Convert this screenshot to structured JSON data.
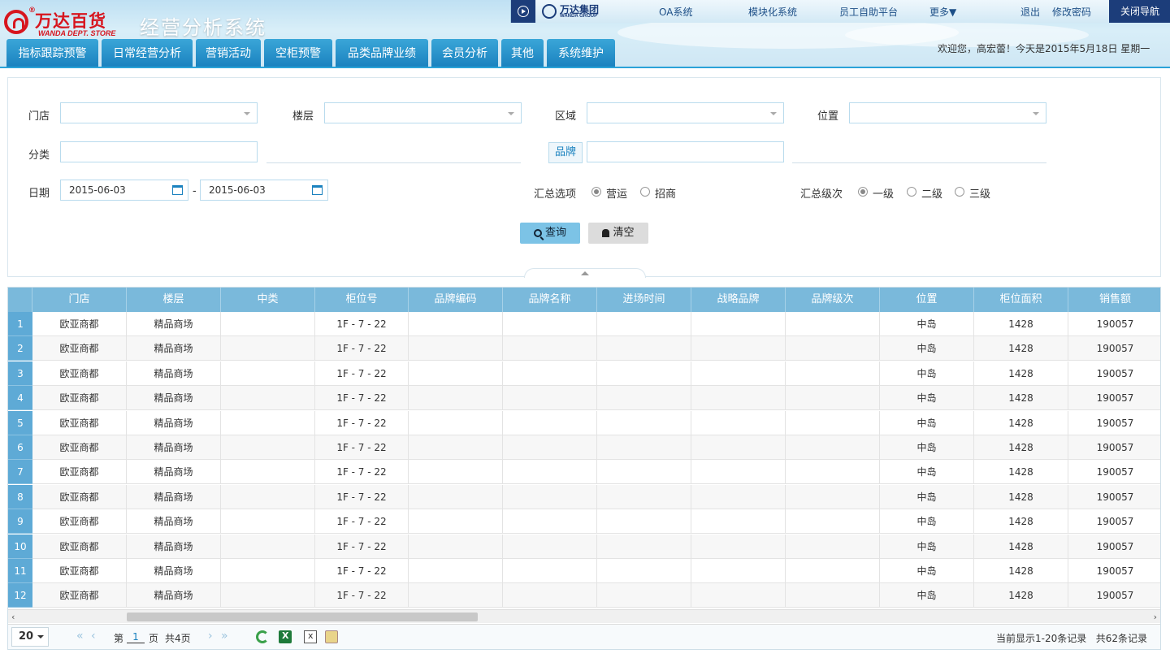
{
  "header": {
    "logo_cn": "万达百货",
    "logo_en": "WANDA DEPT. STORE",
    "logo_reg": "®",
    "system_title": "经营分析系统",
    "group_logo_cn": "万达集团",
    "group_logo_en": "WANDA GROUP",
    "top_links": [
      "OA系统",
      "模块化系统",
      "员工自助平台",
      "更多▼",
      "退出",
      "修改密码"
    ],
    "close_nav": "关闭导航",
    "welcome": "欢迎您，高宏蕾！今天是2015年5月18日 星期一"
  },
  "tabs": [
    "指标跟踪预警",
    "日常经营分析",
    "营销活动",
    "空柜预警",
    "品类品牌业绩",
    "会员分析",
    "其他",
    "系统维护"
  ],
  "filter": {
    "store_label": "门店",
    "floor_label": "楼层",
    "area_label": "区域",
    "position_label": "位置",
    "category_label": "分类",
    "brand_label": "品牌",
    "date_label": "日期",
    "date_from": "2015-06-03",
    "date_to": "2015-06-03",
    "date_sep": "-",
    "summary_option_label": "汇总选项",
    "summary_options": [
      "营运",
      "招商"
    ],
    "summary_level_label": "汇总级次",
    "summary_levels": [
      "一级",
      "二级",
      "三级"
    ],
    "search_button": "查询",
    "clear_button": "清空"
  },
  "grid": {
    "columns": [
      "门店",
      "楼层",
      "中类",
      "柜位号",
      "品牌编码",
      "品牌名称",
      "进场时间",
      "战略品牌",
      "品牌级次",
      "位置",
      "柜位面积",
      "销售额"
    ],
    "rows": [
      {
        "n": "1",
        "cells": [
          "欧亚商都",
          "精品商场",
          "",
          "1F - 7 - 22",
          "",
          "",
          "",
          "",
          "",
          "中岛",
          "1428",
          "190057"
        ]
      },
      {
        "n": "2",
        "cells": [
          "欧亚商都",
          "精品商场",
          "",
          "1F - 7 - 22",
          "",
          "",
          "",
          "",
          "",
          "中岛",
          "1428",
          "190057"
        ]
      },
      {
        "n": "3",
        "cells": [
          "欧亚商都",
          "精品商场",
          "",
          "1F - 7 - 22",
          "",
          "",
          "",
          "",
          "",
          "中岛",
          "1428",
          "190057"
        ]
      },
      {
        "n": "4",
        "cells": [
          "欧亚商都",
          "精品商场",
          "",
          "1F - 7 - 22",
          "",
          "",
          "",
          "",
          "",
          "中岛",
          "1428",
          "190057"
        ]
      },
      {
        "n": "5",
        "cells": [
          "欧亚商都",
          "精品商场",
          "",
          "1F - 7 - 22",
          "",
          "",
          "",
          "",
          "",
          "中岛",
          "1428",
          "190057"
        ]
      },
      {
        "n": "6",
        "cells": [
          "欧亚商都",
          "精品商场",
          "",
          "1F - 7 - 22",
          "",
          "",
          "",
          "",
          "",
          "中岛",
          "1428",
          "190057"
        ]
      },
      {
        "n": "7",
        "cells": [
          "欧亚商都",
          "精品商场",
          "",
          "1F - 7 - 22",
          "",
          "",
          "",
          "",
          "",
          "中岛",
          "1428",
          "190057"
        ]
      },
      {
        "n": "8",
        "cells": [
          "欧亚商都",
          "精品商场",
          "",
          "1F - 7 - 22",
          "",
          "",
          "",
          "",
          "",
          "中岛",
          "1428",
          "190057"
        ]
      },
      {
        "n": "9",
        "cells": [
          "欧亚商都",
          "精品商场",
          "",
          "1F - 7 - 22",
          "",
          "",
          "",
          "",
          "",
          "中岛",
          "1428",
          "190057"
        ]
      },
      {
        "n": "10",
        "cells": [
          "欧亚商都",
          "精品商场",
          "",
          "1F - 7 - 22",
          "",
          "",
          "",
          "",
          "",
          "中岛",
          "1428",
          "190057"
        ]
      },
      {
        "n": "11",
        "cells": [
          "欧亚商都",
          "精品商场",
          "",
          "1F - 7 - 22",
          "",
          "",
          "",
          "",
          "",
          "中岛",
          "1428",
          "190057"
        ]
      },
      {
        "n": "12",
        "cells": [
          "欧亚商都",
          "精品商场",
          "",
          "1F - 7 - 22",
          "",
          "",
          "",
          "",
          "",
          "中岛",
          "1428",
          "190057"
        ]
      }
    ]
  },
  "pager": {
    "page_size": "20",
    "first": "«",
    "prev": "‹",
    "next": "›",
    "last": "»",
    "page_prefix": "第",
    "current_page": "1",
    "page_suffix": "页",
    "total_pages": "共4页",
    "display_info": "当前显示1-20条记录",
    "total_records": "共62条记录"
  },
  "scroll": {
    "left_arrow": "‹",
    "right_arrow": "›"
  },
  "colors": {
    "accent": "#1b82bf",
    "tab": "#2a95cf",
    "grid_header": "#7ab9db",
    "dark_nav": "#1c3d7a",
    "brand_red": "#d7161f"
  }
}
